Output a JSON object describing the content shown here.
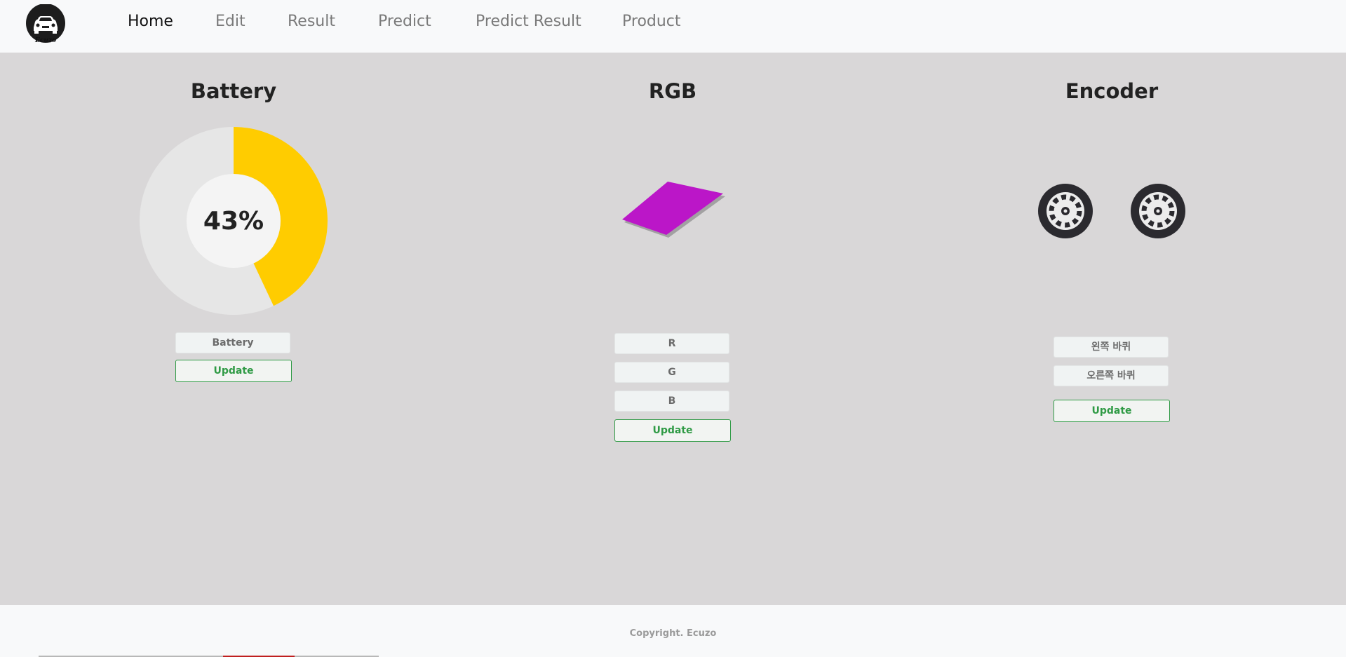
{
  "brand": {
    "name": "Ecuzo"
  },
  "nav": [
    "Home",
    "Edit",
    "Result",
    "Predict",
    "Predict Result",
    "Product"
  ],
  "battery": {
    "title": "Battery",
    "percent": 43,
    "percent_label": "43%",
    "input_placeholder": "Battery",
    "update_label": "Update",
    "colors": {
      "fill": "#ffcc00",
      "track": "#e6e6e6",
      "center": "#f4f4f4"
    }
  },
  "rgb": {
    "title": "RGB",
    "swatch_color": "#bb16c8",
    "inputs": [
      "R",
      "G",
      "B"
    ],
    "update_label": "Update"
  },
  "encoder": {
    "title": "Encoder",
    "left_placeholder": "왼쪽 바퀴",
    "right_placeholder": "오른쪽 바퀴",
    "update_label": "Update"
  },
  "footer": {
    "copyright": "Copyright. Ecuzo"
  }
}
